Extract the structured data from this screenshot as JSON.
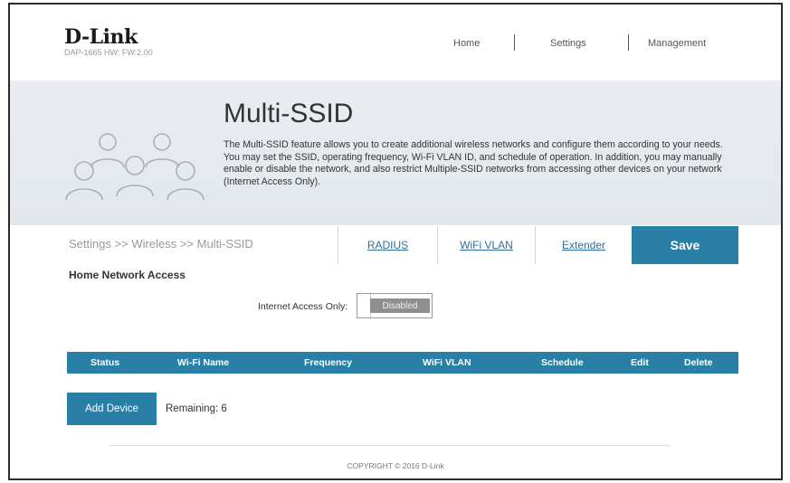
{
  "header": {
    "brand": "D-Link",
    "model": "DAP-1665 HW: FW:2.00",
    "nav": [
      "Home",
      "Settings",
      "Management"
    ]
  },
  "banner": {
    "title": "Multi-SSID",
    "description": "The Multi-SSID feature allows you to create additional wireless networks and configure them according to your needs. You may set the SSID, operating frequency, Wi-Fi VLAN ID, and schedule of operation. In addition, you may manually enable or disable the network, and also restrict Multiple-SSID networks from accessing other devices on your network (Internet Access Only).",
    "icon": "people-group-icon"
  },
  "tabbar": {
    "breadcrumb": "Settings >> Wireless >> Multi-SSID",
    "tabs": [
      "RADIUS",
      "WiFi VLAN",
      "Extender"
    ],
    "save_label": "Save"
  },
  "section": {
    "title": "Home Network Access",
    "internet_access_label": "Internet Access Only:",
    "internet_access_value": "Disabled"
  },
  "table": {
    "columns": [
      "Status",
      "Wi-Fi Name",
      "Frequency",
      "WiFi VLAN",
      "Schedule",
      "Edit",
      "Delete"
    ]
  },
  "actions": {
    "add_device_label": "Add Device",
    "remaining": "Remaining: 6"
  },
  "footer": {
    "copyright": "COPYRIGHT © 2016 D-Link"
  },
  "colors": {
    "accent": "#2a7fa6",
    "banner_bg": "#e6eaee",
    "toggle_disabled": "#8f8f8f"
  }
}
